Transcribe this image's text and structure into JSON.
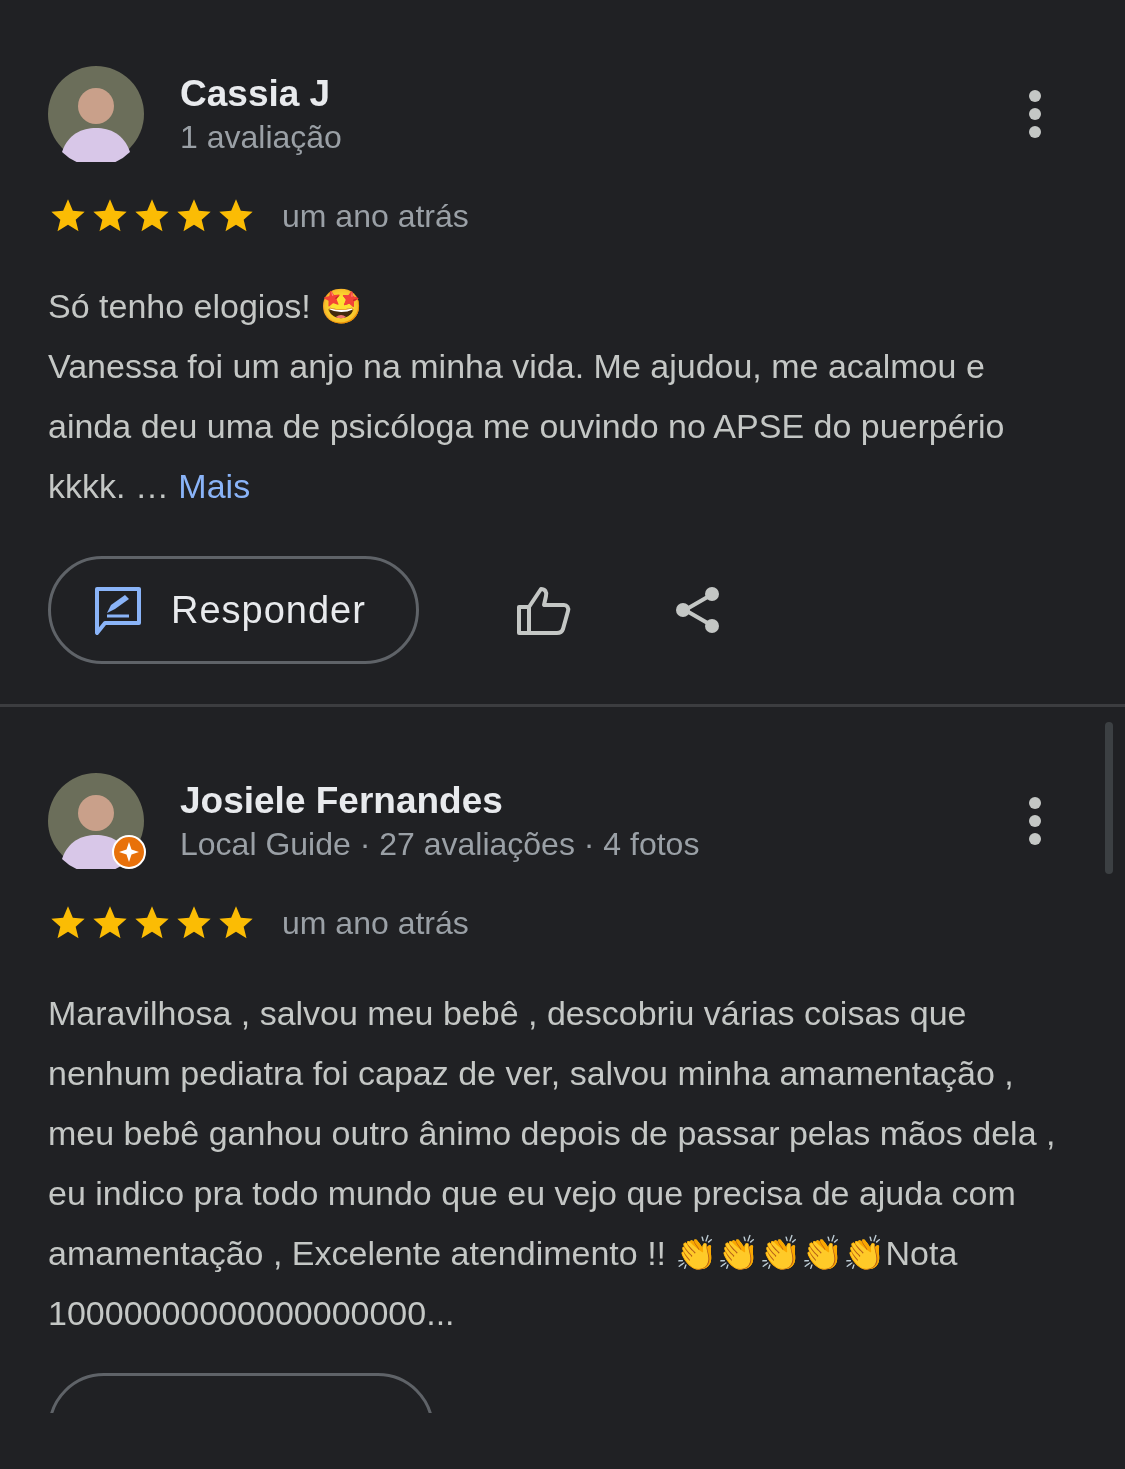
{
  "reviews": [
    {
      "name": "Cassia J",
      "meta": [
        "1 avaliação"
      ],
      "local_guide": false,
      "stars": 5,
      "time": "um ano atrás",
      "text": "Só tenho elogios! 🤩\nVanessa foi um anjo na minha vida. Me ajudou, me acalmou e ainda deu uma de psicóloga me ouvindo no APSE do puerpério kkkk. …",
      "more_link": "Mais",
      "reply_label": "Responder",
      "reply_cut": false
    },
    {
      "name": "Josiele Fernandes",
      "meta": [
        "Local Guide · 27 avaliações · 4 fotos"
      ],
      "local_guide": true,
      "stars": 5,
      "time": "um ano atrás",
      "text": "Maravilhosa , salvou meu bebê , descobriu várias coisas que nenhum pediatra foi capaz de ver, salvou minha amamentação , meu bebê ganhou outro ânimo depois de passar pelas mãos dela , eu indico pra todo mundo que eu vejo que precisa de ajuda com amamentação , Excelente atendimento !! 👏👏👏👏👏Nota 10000000000000000000...",
      "reply_cut": true
    }
  ]
}
